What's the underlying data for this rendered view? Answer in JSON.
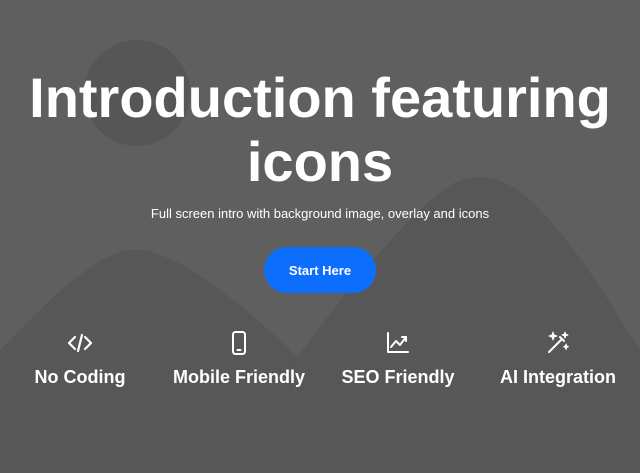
{
  "hero": {
    "title": "Introduction featuring icons",
    "subtitle": "Full screen intro with background image, overlay and icons",
    "cta_label": "Start Here"
  },
  "features": [
    {
      "label": "No Coding",
      "icon": "code-icon"
    },
    {
      "label": "Mobile Friendly",
      "icon": "mobile-phone-icon"
    },
    {
      "label": "SEO Friendly",
      "icon": "line-chart-icon"
    },
    {
      "label": "AI Integration",
      "icon": "magic-wand-icon"
    }
  ],
  "colors": {
    "background": "#5f5f5f",
    "shapes": "#555555",
    "accent": "#0d6efd",
    "text": "#ffffff"
  }
}
